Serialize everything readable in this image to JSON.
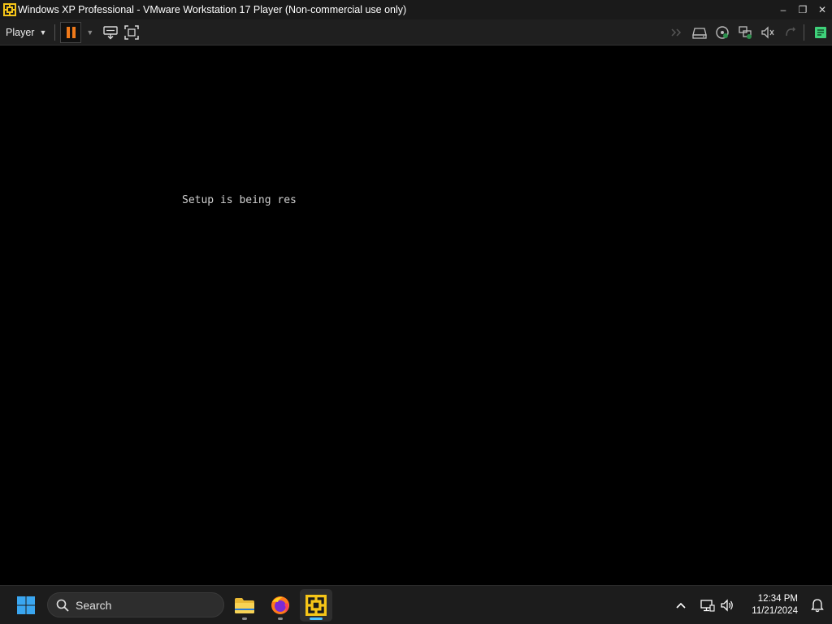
{
  "window": {
    "title": "Windows XP Professional - VMware Workstation 17 Player (Non-commercial use only)",
    "controls": {
      "minimize": "–",
      "restore": "❐",
      "close": "✕"
    }
  },
  "toolbar": {
    "player_menu_label": "Player",
    "left_icons": [
      "pause-icon",
      "send-ctrl-alt-del-icon",
      "fullscreen-icon"
    ],
    "right_icons": [
      "send-forward-icon",
      "hard-disk-icon",
      "cd-dvd-icon",
      "network-adapter-icon",
      "sound-card-icon",
      "usb-icon",
      "notes-icon"
    ]
  },
  "vm_screen": {
    "text": "Setup is being res"
  },
  "taskbar": {
    "search_placeholder": "Search",
    "apps": [
      {
        "name": "File Explorer",
        "icon": "folder-icon"
      },
      {
        "name": "Firefox",
        "icon": "firefox-icon"
      },
      {
        "name": "VMware Workstation Player",
        "icon": "vmware-icon",
        "active": true
      }
    ],
    "clock": {
      "time": "12:34 PM",
      "date": "11/21/2024"
    }
  },
  "colors": {
    "accent_pause": "#f07a1a",
    "vmware_yellow": "#f5c518",
    "taskbar_indicator": "#4cc2ff",
    "notes_green": "#3fd17a"
  }
}
